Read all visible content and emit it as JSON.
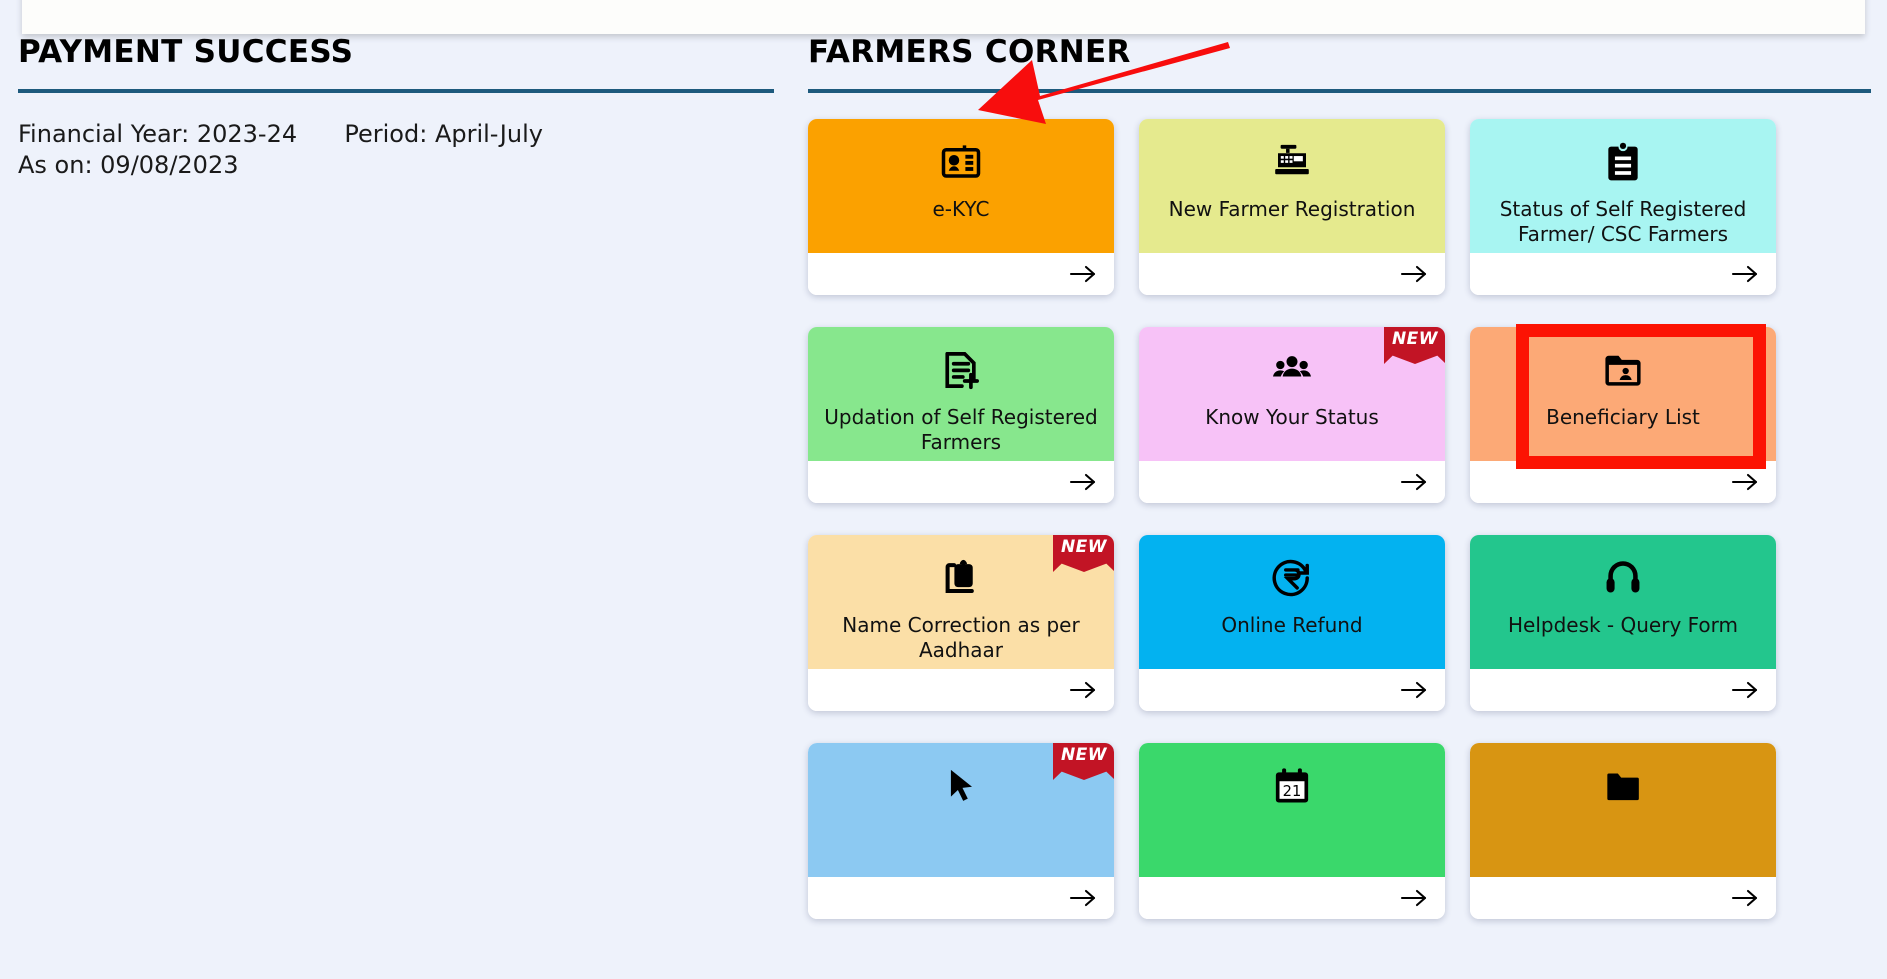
{
  "top_strip": {
    "green_bar_left": "",
    "green_bar_right": "",
    "bar_color": "#22a34a"
  },
  "left_panel": {
    "title": "PAYMENT SUCCESS",
    "rule_color": "#1d5a7d",
    "meta": {
      "financial_year_label": "Financial Year: 2023-24",
      "period_label": "Period: April-July",
      "as_on_label": "As on: 09/08/2023"
    }
  },
  "right_panel": {
    "title": "FARMERS CORNER",
    "rule_color": "#1d5a7d",
    "new_badge_text": "NEW",
    "arrow_glyph": "arrow-right-icon",
    "highlight_color": "#fc1303",
    "cards": [
      {
        "label": "e-KYC",
        "color": "#fba100",
        "icon": "id-card-icon",
        "badge": "",
        "highlighted": false
      },
      {
        "label": "New Farmer Registration",
        "color": "#e5ea8e",
        "icon": "cash-register-icon",
        "badge": "",
        "highlighted": false
      },
      {
        "label": "Status of Self Registered Farmer/ CSC Farmers",
        "color": "#a8f5f2",
        "icon": "clipboard-icon",
        "badge": "",
        "highlighted": false
      },
      {
        "label": "Updation of Self Registered Farmers",
        "color": "#87e78d",
        "icon": "document-plus-icon",
        "badge": "",
        "highlighted": false
      },
      {
        "label": "Know Your Status",
        "color": "#f7c2f7",
        "icon": "people-group-icon",
        "badge": "NEW",
        "highlighted": false
      },
      {
        "label": "Beneficiary List",
        "color": "#fca976",
        "icon": "folder-person-icon",
        "badge": "",
        "highlighted": true
      },
      {
        "label": "Name Correction as per Aadhaar",
        "color": "#fbdfa7",
        "icon": "clipboard-copy-icon",
        "badge": "NEW",
        "highlighted": false
      },
      {
        "label": "Online Refund",
        "color": "#03b2f0",
        "icon": "rupee-refund-icon",
        "badge": "",
        "highlighted": false
      },
      {
        "label": "Helpdesk - Query Form",
        "color": "#23c68d",
        "icon": "headset-icon",
        "badge": "",
        "highlighted": false
      },
      {
        "label": "",
        "color": "#8cc9f2",
        "icon": "cursor-click-icon",
        "badge": "NEW",
        "highlighted": false
      },
      {
        "label": "",
        "color": "#3ad86b",
        "icon": "calendar-icon",
        "badge": "",
        "highlighted": false
      },
      {
        "label": "",
        "color": "#d89512",
        "icon": "folder-icon",
        "badge": "",
        "highlighted": false
      }
    ]
  },
  "annotation": {
    "type": "red-arrow",
    "color": "#f80d0d",
    "points_to": "FARMERS CORNER"
  }
}
